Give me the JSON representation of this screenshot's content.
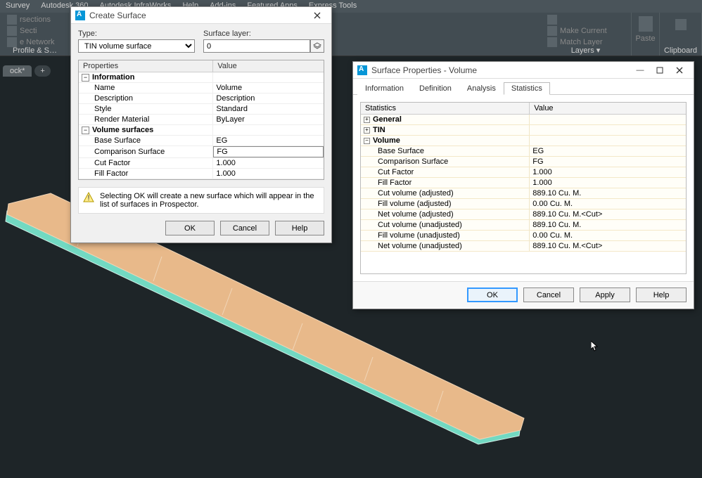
{
  "ribbon": {
    "tabs": [
      "Survey",
      "Autodesk 360",
      "Autodesk InfraWorks",
      "Help",
      "Add-ins",
      "Featured Apps",
      "Express Tools"
    ],
    "left_items": [
      "rsections",
      "Secti",
      "e Network"
    ],
    "left_panel": "Profile & S",
    "layers_items": [
      "",
      "Make Current",
      "Match Layer"
    ],
    "layers_label": "Layers",
    "paste_label": "Paste",
    "clipboard_label": "Clipboard"
  },
  "doctab": {
    "name": "ock*"
  },
  "create_surface": {
    "title": "Create Surface",
    "type_label": "Type:",
    "type_value": "TIN volume surface",
    "layer_label": "Surface layer:",
    "layer_value": "0",
    "grid_headers": {
      "properties": "Properties",
      "value": "Value"
    },
    "groups": [
      {
        "name": "Information",
        "rows": [
          {
            "p": "Name",
            "v": "Volume"
          },
          {
            "p": "Description",
            "v": "Description"
          },
          {
            "p": "Style",
            "v": "Standard"
          },
          {
            "p": "Render Material",
            "v": "ByLayer"
          }
        ]
      },
      {
        "name": "Volume surfaces",
        "rows": [
          {
            "p": "Base Surface",
            "v": "EG"
          },
          {
            "p": "Comparison Surface",
            "v": "FG",
            "selected": true
          },
          {
            "p": "Cut Factor",
            "v": "1.000"
          },
          {
            "p": "Fill Factor",
            "v": "1.000"
          }
        ]
      }
    ],
    "info_text": "Selecting OK will create a new surface which will appear in the list of surfaces in Prospector.",
    "buttons": {
      "ok": "OK",
      "cancel": "Cancel",
      "help": "Help"
    }
  },
  "surface_properties": {
    "title": "Surface Properties - Volume",
    "tabs": [
      "Information",
      "Definition",
      "Analysis",
      "Statistics"
    ],
    "active_tab": 3,
    "grid_headers": {
      "statistics": "Statistics",
      "value": "Value"
    },
    "groups": [
      {
        "name": "General",
        "expanded": false,
        "rows": []
      },
      {
        "name": "TIN",
        "expanded": false,
        "rows": []
      },
      {
        "name": "Volume",
        "expanded": true,
        "rows": [
          {
            "p": "Base Surface",
            "v": "EG"
          },
          {
            "p": "Comparison Surface",
            "v": "FG"
          },
          {
            "p": "Cut Factor",
            "v": "1.000"
          },
          {
            "p": "Fill Factor",
            "v": "1.000"
          },
          {
            "p": "Cut volume (adjusted)",
            "v": "889.10 Cu. M."
          },
          {
            "p": "Fill volume (adjusted)",
            "v": "0.00 Cu. M."
          },
          {
            "p": "Net volume (adjusted)",
            "v": "889.10 Cu. M.<Cut>"
          },
          {
            "p": "Cut volume (unadjusted)",
            "v": "889.10 Cu. M."
          },
          {
            "p": "Fill volume (unadjusted)",
            "v": "0.00 Cu. M."
          },
          {
            "p": "Net volume (unadjusted)",
            "v": "889.10 Cu. M.<Cut>"
          }
        ]
      }
    ],
    "buttons": {
      "ok": "OK",
      "cancel": "Cancel",
      "apply": "Apply",
      "help": "Help"
    }
  }
}
